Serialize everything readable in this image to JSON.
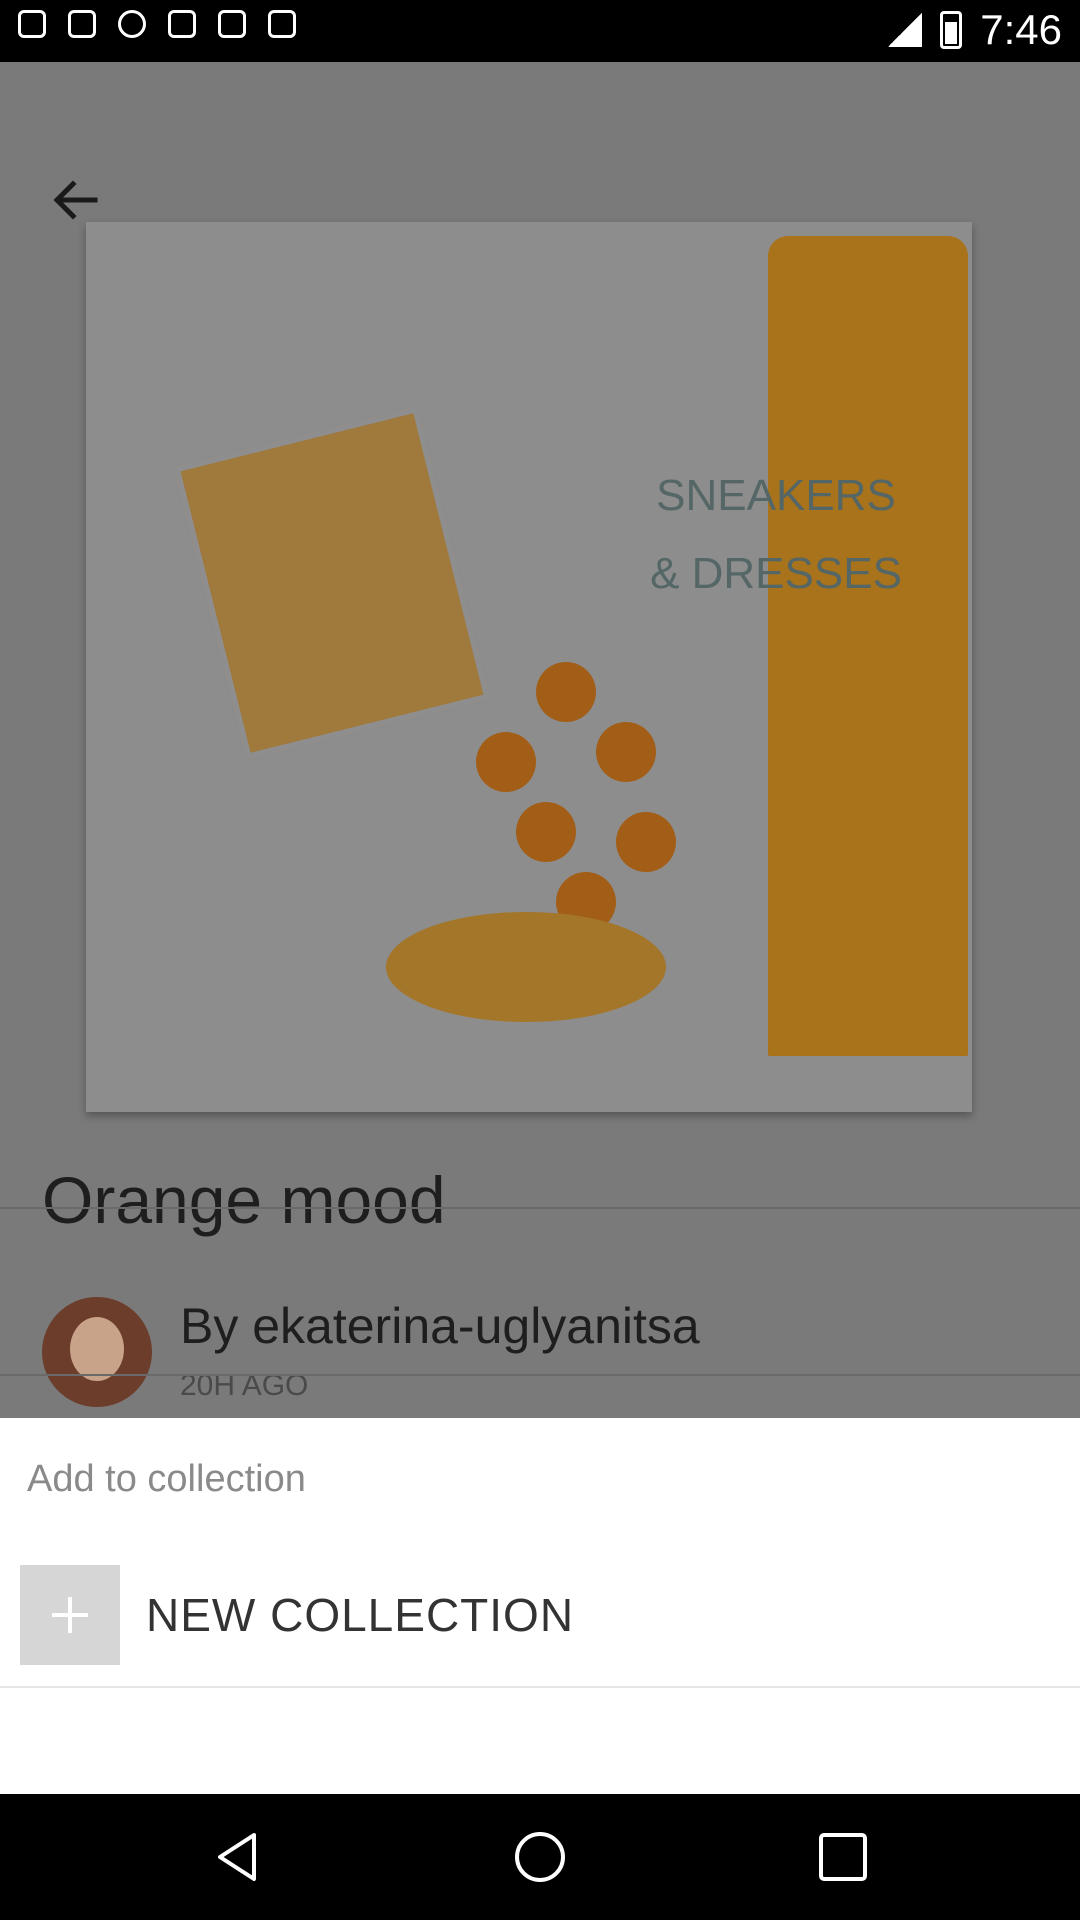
{
  "status_bar": {
    "time": "7:46",
    "left_icons": [
      "gallery-icon",
      "flipboard-icon",
      "data-saver-icon",
      "fake-gps-icon",
      "lock-icon",
      "instagram-icon"
    ],
    "right_icons": [
      "signal-icon",
      "battery-icon"
    ]
  },
  "post": {
    "artwork_text": [
      "SNEAKERS",
      "& DRESSES"
    ],
    "title": "Orange mood",
    "author_line": "By ekaterina-uglyanitsa",
    "time_ago": "20H AGO"
  },
  "sheet": {
    "title": "Add to collection",
    "new_collection_label": "NEW COLLECTION"
  },
  "nav": {
    "buttons": [
      "back-triangle-icon",
      "home-circle-icon",
      "recents-square-icon"
    ]
  }
}
